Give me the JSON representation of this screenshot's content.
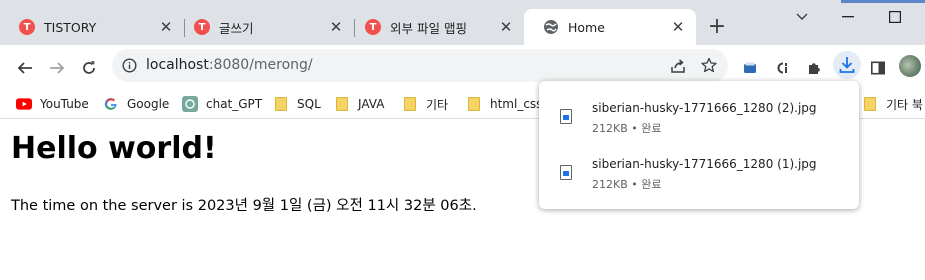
{
  "tabs": [
    {
      "title": "TISTORY",
      "favicon": "tistory-icon"
    },
    {
      "title": "글쓰기",
      "favicon": "tistory-icon"
    },
    {
      "title": "외부 파일 맵핑",
      "favicon": "tistory-icon"
    },
    {
      "title": "Home",
      "favicon": "globe-icon",
      "active": true
    }
  ],
  "tab_close_glyph": "✕",
  "new_tab_glyph": "+",
  "address_bar": {
    "host": "localhost",
    "rest": ":8080/merong/"
  },
  "bookmarks": [
    {
      "label": "YouTube",
      "icon": "youtube-icon"
    },
    {
      "label": "Google",
      "icon": "google-icon"
    },
    {
      "label": "chat_GPT",
      "icon": "chatgpt-icon"
    },
    {
      "label": "SQL",
      "icon": "folder-icon"
    },
    {
      "label": "JAVA",
      "icon": "folder-icon"
    },
    {
      "label": "기타",
      "icon": "folder-icon"
    },
    {
      "label": "html_css_",
      "icon": "folder-icon"
    },
    {
      "label": "기타 북",
      "icon": "folder-icon"
    }
  ],
  "page": {
    "heading": "Hello world!",
    "server_time": "The time on the server is 2023년 9월 1일 (금) 오전 11시 32분 06초."
  },
  "downloads": [
    {
      "filename": "siberian-husky-1771666_1280 (2).jpg",
      "status": "212KB • 완료"
    },
    {
      "filename": "siberian-husky-1771666_1280 (1).jpg",
      "status": "212KB • 완료"
    }
  ],
  "colors": {
    "tabstrip": "#dee1e6",
    "favicon_red": "#f24f4f",
    "download_accent": "#1a73e8",
    "folder": "#f4d466"
  }
}
